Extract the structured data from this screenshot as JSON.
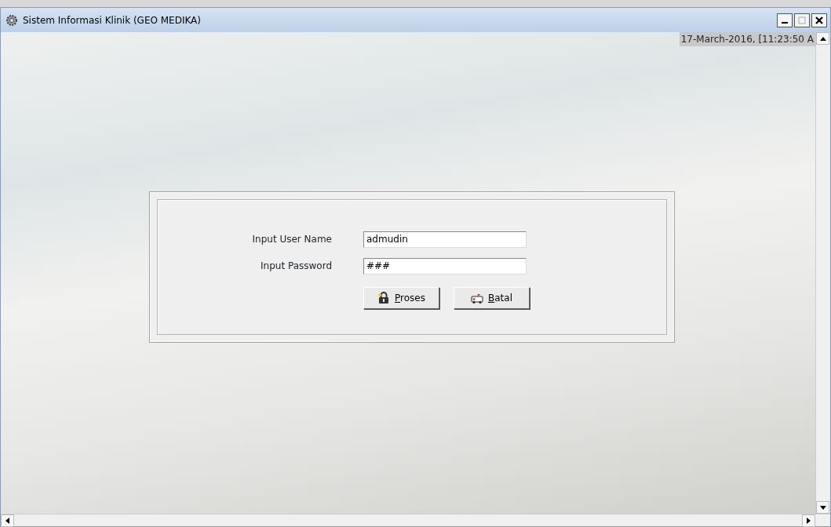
{
  "window": {
    "title": "Sistem Informasi Klinik (GEO MEDIKA)"
  },
  "datetime": "17-March-2016, [11:23:50 A",
  "login": {
    "fields": [
      {
        "label": "Input User Name",
        "value": "admudin"
      },
      {
        "label": "Input Password",
        "value": "###"
      }
    ],
    "buttons": [
      {
        "label": "Proses",
        "kind": "lock"
      },
      {
        "label": "Batal",
        "kind": "ambulance"
      }
    ]
  }
}
